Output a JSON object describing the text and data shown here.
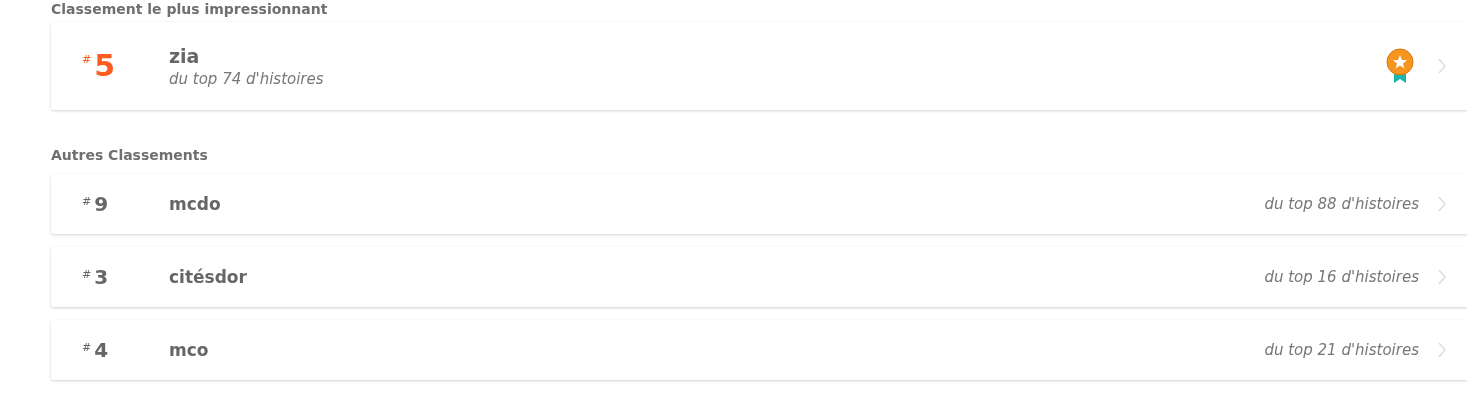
{
  "featured": {
    "heading": "Classement le plus impressionnant",
    "item": {
      "hash": "#",
      "rank": "5",
      "name": "zia",
      "subtitle": "du top 74 d'histoires",
      "badge": true
    }
  },
  "others": {
    "heading": "Autres Classements",
    "items": [
      {
        "hash": "#",
        "rank": "9",
        "name": "mcdo",
        "subtitle": "du top 88 d'histoires"
      },
      {
        "hash": "#",
        "rank": "3",
        "name": "citésdor",
        "subtitle": "du top 16 d'histoires"
      },
      {
        "hash": "#",
        "rank": "4",
        "name": "mco",
        "subtitle": "du top 21 d'histoires"
      }
    ]
  }
}
